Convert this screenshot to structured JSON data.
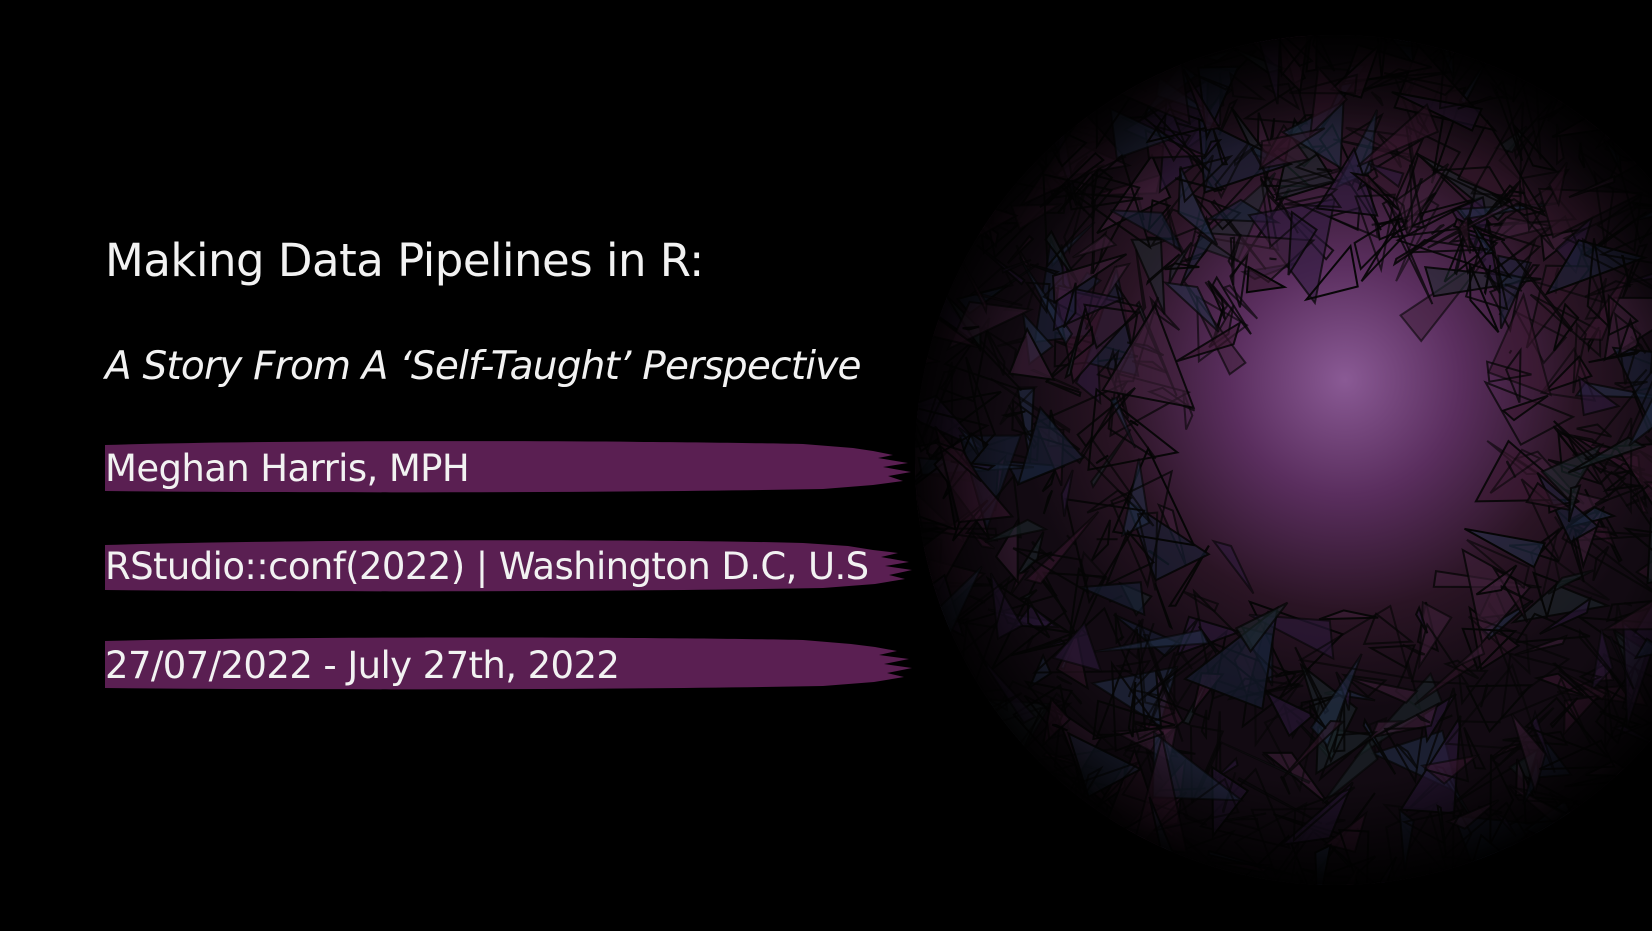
{
  "slide": {
    "title": "Making Data Pipelines in R:",
    "subtitle": "A Story From A ‘Self-Taught’ Perspective",
    "author": "Meghan Harris, MPH",
    "event": "RStudio::conf(2022) | Washington D.C, U.S",
    "date": "27/07/2022 - July 27th, 2022"
  },
  "colors": {
    "background": "#000000",
    "brush_band": "#5a1f52",
    "text": "#f2f2f2",
    "art_glow": "#7a4a86"
  }
}
